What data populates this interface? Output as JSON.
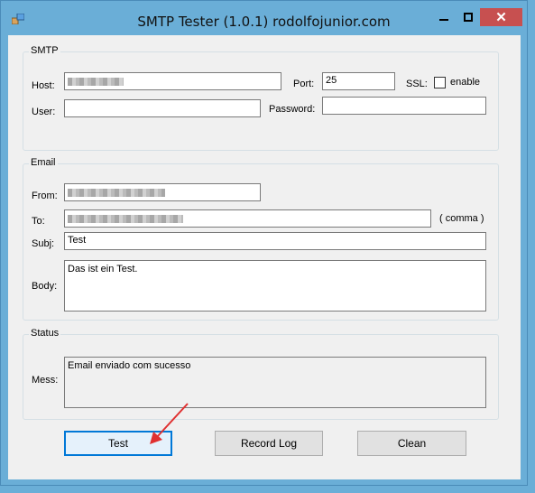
{
  "window": {
    "title": "SMTP Tester (1.0.1)   rodolfojunior.com",
    "minimize_glyph": "▁",
    "maximize_glyph": "□",
    "close_glyph": "✕"
  },
  "smtp": {
    "group_title": "SMTP",
    "host_label": "Host:",
    "host_value": "",
    "port_label": "Port:",
    "port_value": "25",
    "ssl_label": "SSL:",
    "ssl_checkbox_label": "enable",
    "ssl_checked": false,
    "user_label": "User:",
    "user_value": "",
    "password_label": "Password:",
    "password_value": ""
  },
  "email": {
    "group_title": "Email",
    "from_label": "From:",
    "from_value": "",
    "to_label": "To:",
    "to_value": "",
    "to_hint": "( comma )",
    "subj_label": "Subj:",
    "subj_value": "Test",
    "body_label": "Body:",
    "body_value": "Das ist ein Test."
  },
  "status": {
    "group_title": "Status",
    "mess_label": "Mess:",
    "mess_value": "Email enviado com sucesso"
  },
  "buttons": {
    "test_label": "Test",
    "record_log_label": "Record Log",
    "clean_label": "Clean"
  },
  "colors": {
    "title_bar": "#6aaed7",
    "client": "#f0f0f0",
    "close_button": "#c75050",
    "arrow": "#e03030",
    "focus": "#0078d7"
  }
}
